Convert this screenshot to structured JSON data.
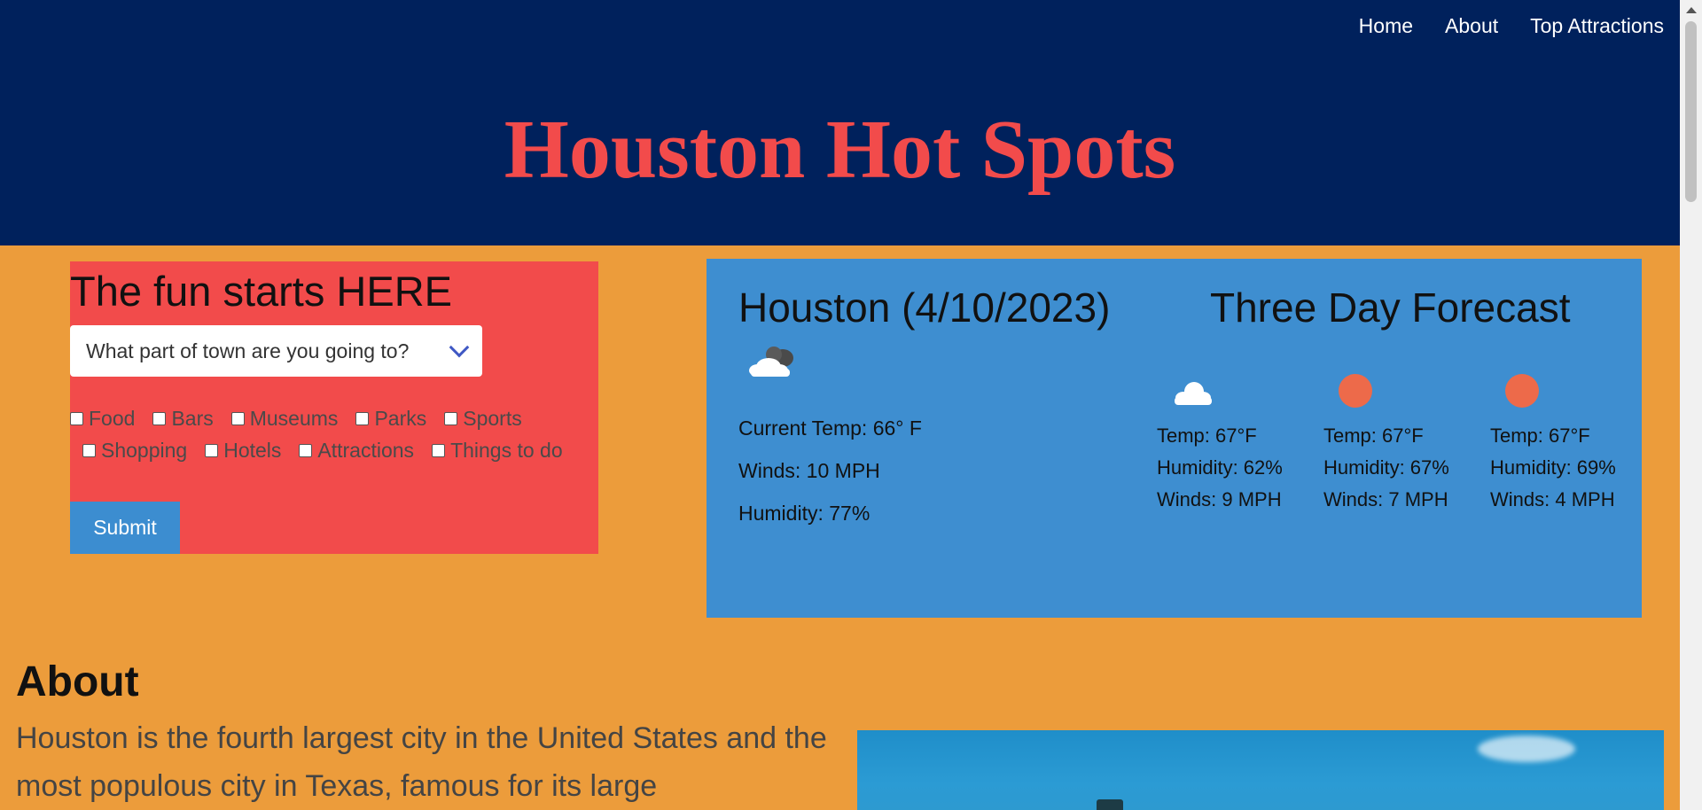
{
  "nav": {
    "items": [
      "Home",
      "About",
      "Top Attractions"
    ]
  },
  "header": {
    "title": "Houston Hot Spots"
  },
  "search": {
    "title": "The fun starts HERE",
    "dropdown_placeholder": "What part of town are you going to?",
    "categories_row1": [
      "Food",
      "Bars",
      "Museums",
      "Parks",
      "Sports"
    ],
    "categories_row2": [
      "Shopping",
      "Hotels",
      "Attractions",
      "Things to do"
    ],
    "submit_label": "Submit"
  },
  "weather": {
    "city_date": "Houston (4/10/2023)",
    "current_icon": "cloud-icon",
    "current_temp": "Current Temp: 66° F",
    "current_winds": "Winds: 10 MPH",
    "current_humidity": "Humidity: 77%",
    "forecast_title": "Three Day Forecast",
    "forecast": [
      {
        "icon": "cloud-icon",
        "temp": "Temp: 67°F",
        "humidity": "Humidity: 62%",
        "winds": "Winds: 9 MPH"
      },
      {
        "icon": "sun-icon",
        "temp": "Temp: 67°F",
        "humidity": "Humidity: 67%",
        "winds": "Winds: 7 MPH"
      },
      {
        "icon": "sun-icon",
        "temp": "Temp: 67°F",
        "humidity": "Humidity: 69%",
        "winds": "Winds: 4 MPH"
      }
    ]
  },
  "about": {
    "title": "About",
    "text": "Houston is the fourth largest city in the United States and the most populous city in Texas, famous for its large"
  },
  "colors": {
    "page_bg": "#ec9c3b",
    "header_bg": "#00215c",
    "title_red": "#f24b4b",
    "weather_blue": "#3e8ed0",
    "submit_blue": "#3c8dd0",
    "sun": "#ed6a4a"
  }
}
